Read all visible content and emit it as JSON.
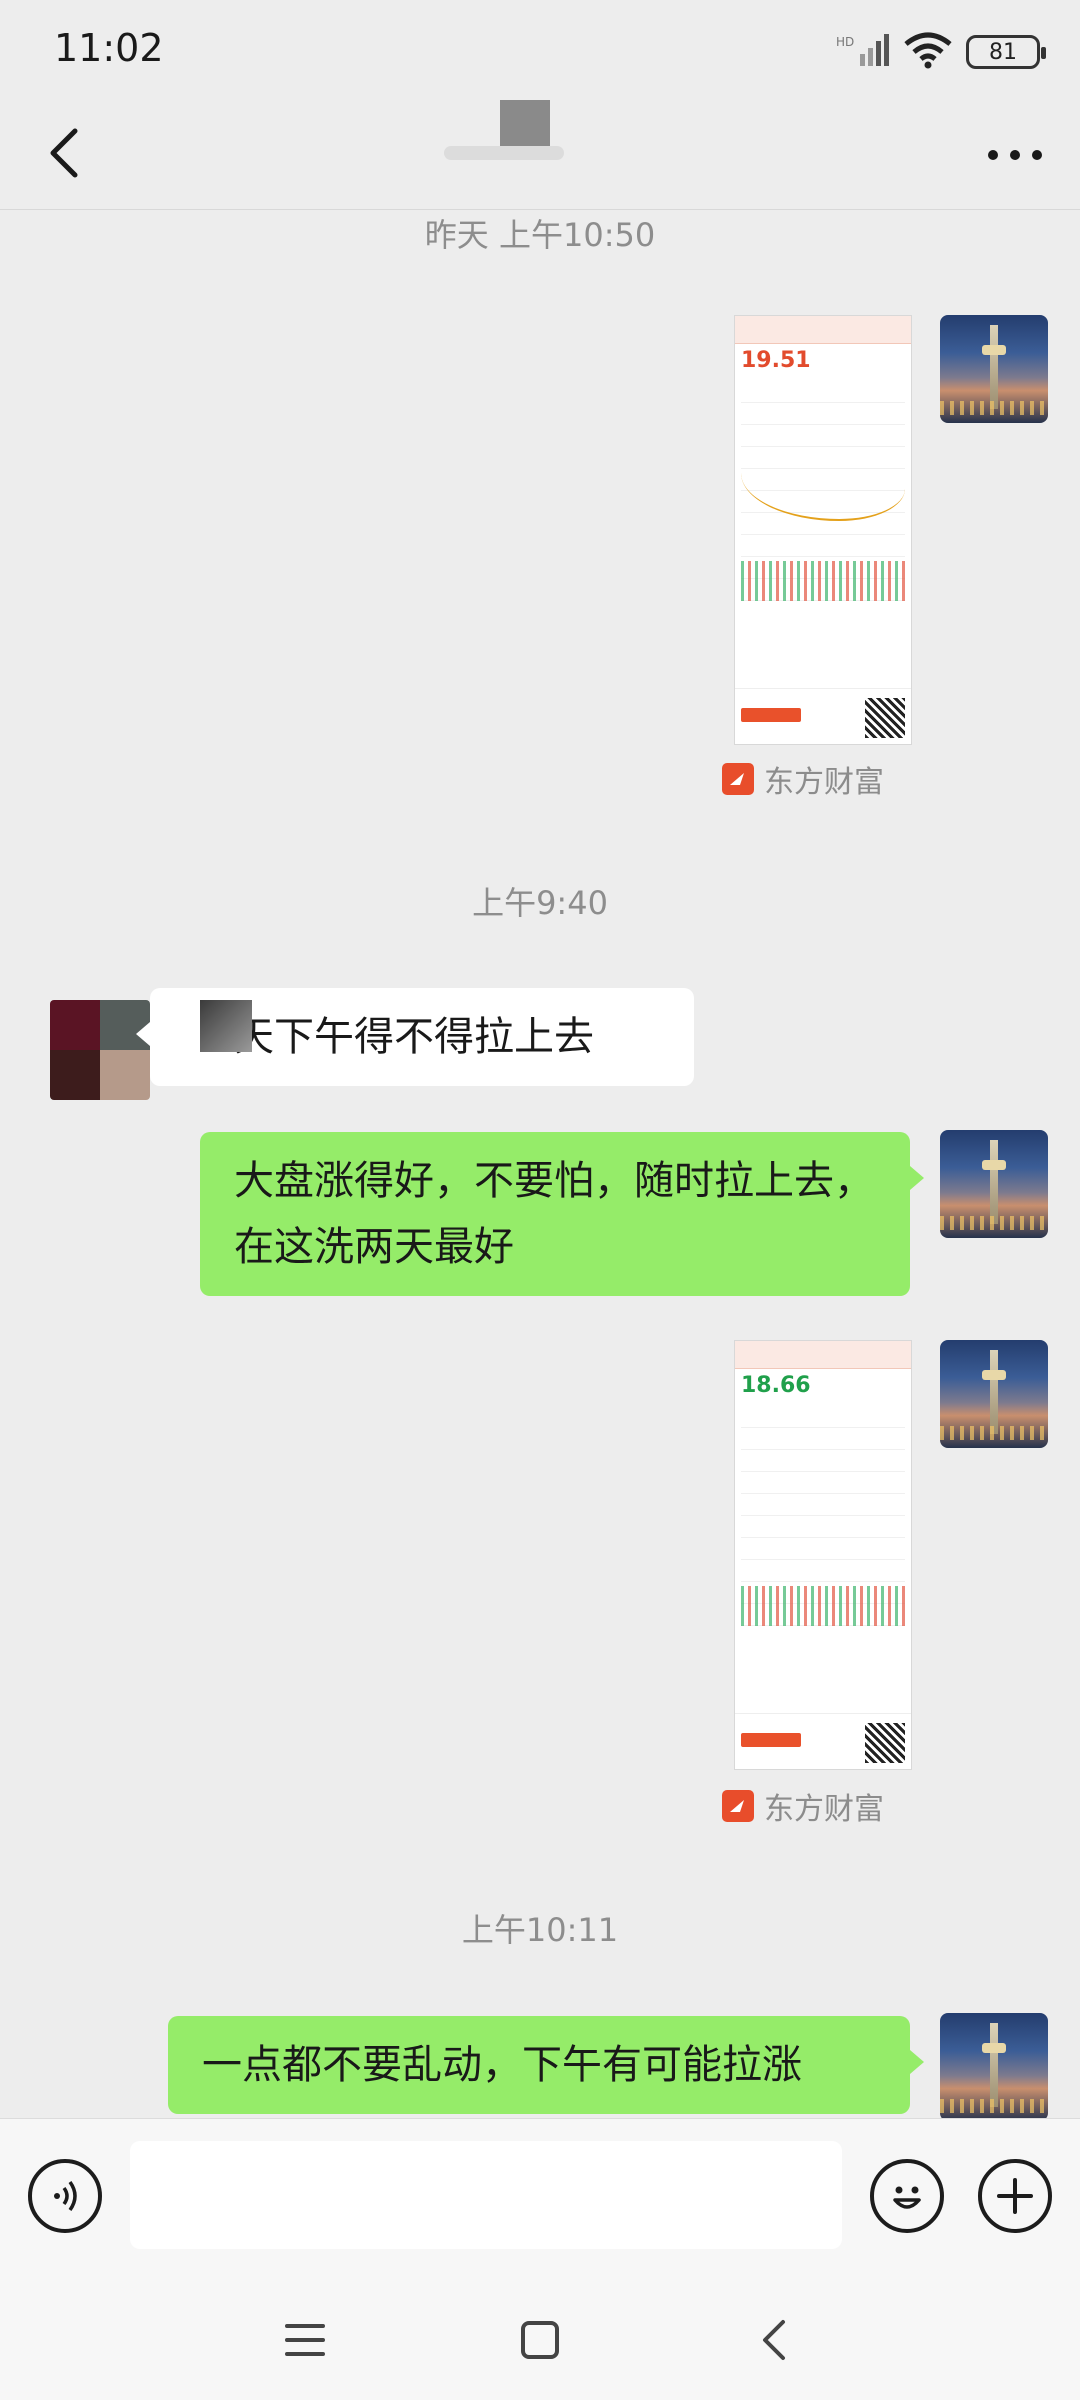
{
  "status_bar": {
    "time": "11:02",
    "battery": "81",
    "network": "HD"
  },
  "header": {
    "back_icon": "back-chevron-icon",
    "more_icon": "more-dots-icon"
  },
  "messages": {
    "time1": "昨天 上午10:50",
    "img1_price": "19.51",
    "source1": "东方财富",
    "time2": "上午9:40",
    "incoming_text": "天下午得不得拉上去",
    "outgoing1_text": "大盘涨得好，不要怕，随时拉上去，在这洗两天最好",
    "img2_price": "18.66",
    "source2": "东方财富",
    "time3": "上午10:11",
    "outgoing2_text": "一点都不要乱动，下午有可能拉涨"
  },
  "input_bar": {
    "placeholder": "",
    "voice_icon": "voice-icon",
    "emoji_icon": "emoji-icon",
    "plus_icon": "plus-icon"
  },
  "colors": {
    "bubble_me": "#95ec69",
    "bubble_other": "#ffffff",
    "background": "#ededed",
    "source_brand": "#e84d2b"
  }
}
